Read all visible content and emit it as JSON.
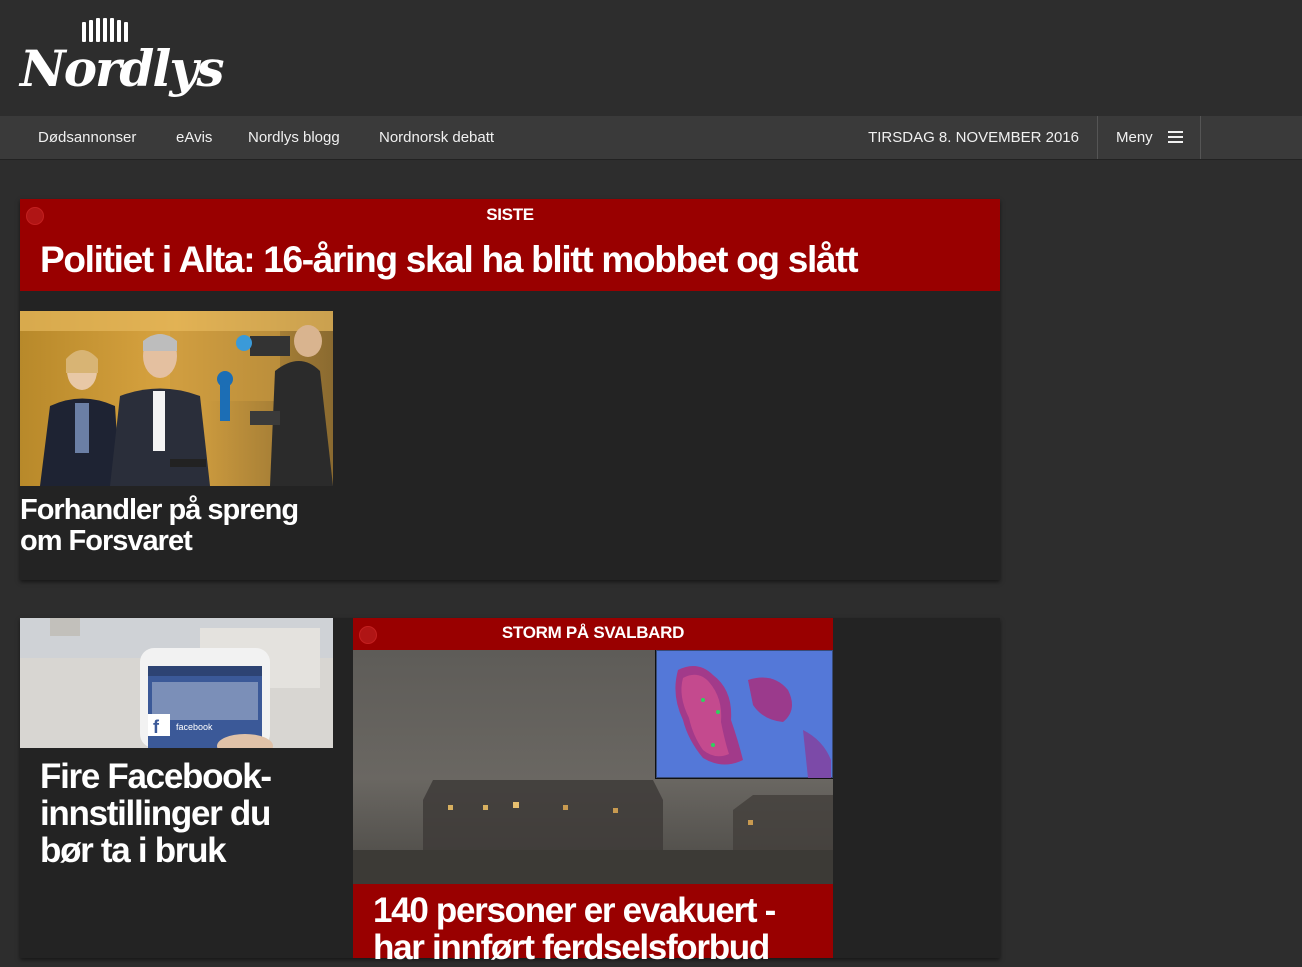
{
  "site": {
    "logo_text": "Nordlys"
  },
  "nav": {
    "items": [
      {
        "label": "Dødsannonser"
      },
      {
        "label": "eAvis"
      },
      {
        "label": "Nordlys blogg"
      },
      {
        "label": "Nordnorsk debatt"
      }
    ],
    "date": "TIRSDAG 8. NOVEMBER 2016",
    "menu_label": "Meny"
  },
  "top_story": {
    "kicker": "SISTE",
    "headline": "Politiet i Alta: 16-åring skal ha blitt mobbet og slått"
  },
  "card1": {
    "headline": "Forhandler på spreng om Forsvaret"
  },
  "card2": {
    "headline": "Fire Facebook-innstillinger du bør ta i bruk",
    "phone_app_label": "facebook"
  },
  "storm": {
    "kicker": "STORM PÅ SVALBARD",
    "headline": "140 personer er evakuert - har innført ferdselsforbud"
  },
  "colors": {
    "background": "#2d2d2d",
    "nav_background": "#3a3a3a",
    "card_background": "#232323",
    "breaking_red": "#990000",
    "text": "#ffffff"
  }
}
